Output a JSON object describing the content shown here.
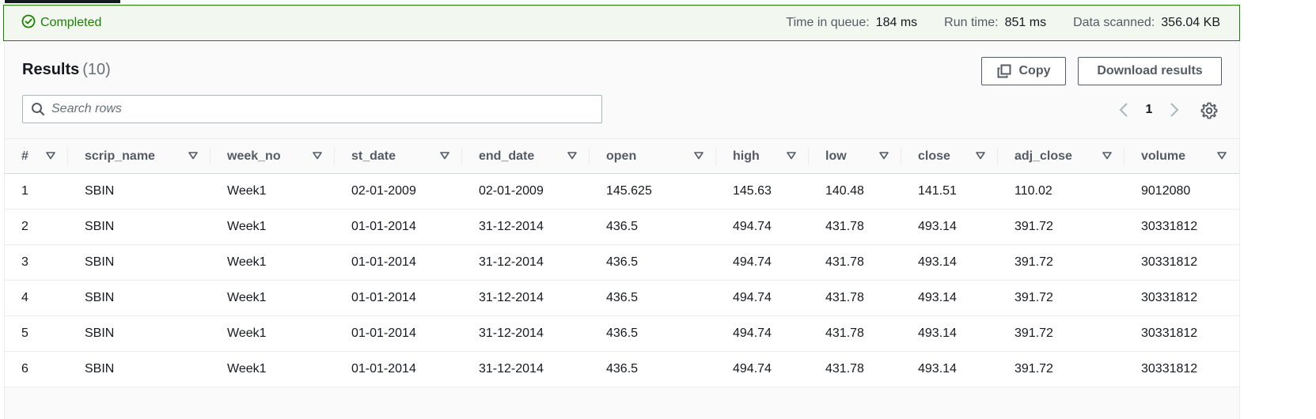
{
  "status": {
    "state": "Completed",
    "metrics": [
      {
        "label": "Time in queue:",
        "value": "184 ms"
      },
      {
        "label": "Run time:",
        "value": "851 ms"
      },
      {
        "label": "Data scanned:",
        "value": "356.04 KB"
      }
    ],
    "success_color": "#1d8102"
  },
  "results": {
    "title": "Results",
    "count": "(10)",
    "copy_label": "Copy",
    "download_label": "Download results",
    "search_placeholder": "Search rows",
    "search_value": "",
    "page": "1"
  },
  "table": {
    "columns": [
      "#",
      "scrip_name",
      "week_no",
      "st_date",
      "end_date",
      "open",
      "high",
      "low",
      "close",
      "adj_close",
      "volume"
    ],
    "rows": [
      [
        "1",
        "SBIN",
        "Week1",
        "02-01-2009",
        "02-01-2009",
        "145.625",
        "145.63",
        "140.48",
        "141.51",
        "110.02",
        "9012080"
      ],
      [
        "2",
        "SBIN",
        "Week1",
        "01-01-2014",
        "31-12-2014",
        "436.5",
        "494.74",
        "431.78",
        "493.14",
        "391.72",
        "30331812"
      ],
      [
        "3",
        "SBIN",
        "Week1",
        "01-01-2014",
        "31-12-2014",
        "436.5",
        "494.74",
        "431.78",
        "493.14",
        "391.72",
        "30331812"
      ],
      [
        "4",
        "SBIN",
        "Week1",
        "01-01-2014",
        "31-12-2014",
        "436.5",
        "494.74",
        "431.78",
        "493.14",
        "391.72",
        "30331812"
      ],
      [
        "5",
        "SBIN",
        "Week1",
        "01-01-2014",
        "31-12-2014",
        "436.5",
        "494.74",
        "431.78",
        "493.14",
        "391.72",
        "30331812"
      ],
      [
        "6",
        "SBIN",
        "Week1",
        "01-01-2014",
        "31-12-2014",
        "436.5",
        "494.74",
        "431.78",
        "493.14",
        "391.72",
        "30331812"
      ]
    ]
  }
}
